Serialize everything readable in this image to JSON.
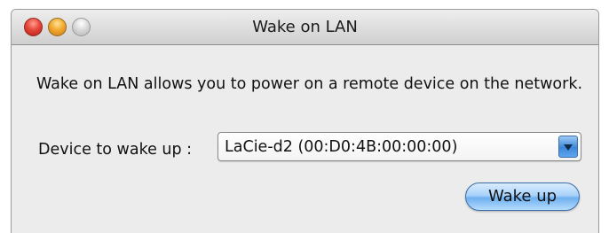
{
  "window": {
    "title": "Wake on LAN"
  },
  "content": {
    "description": "Wake on LAN allows you to power on a remote device on the network.",
    "device_label": "Device to wake up :",
    "device_select_value": "LaCie-d2 (00:D0:4B:00:00:00)"
  },
  "actions": {
    "wake_button_label": "Wake up"
  },
  "colors": {
    "close": "#e64638",
    "minimize": "#f2aa2e",
    "zoom_disabled": "#cfcfcf",
    "accent_blue": "#6fb0f0"
  },
  "icons": {
    "close": "close-icon",
    "minimize": "minimize-icon",
    "zoom": "zoom-icon",
    "dropdown": "chevron-down-icon"
  }
}
